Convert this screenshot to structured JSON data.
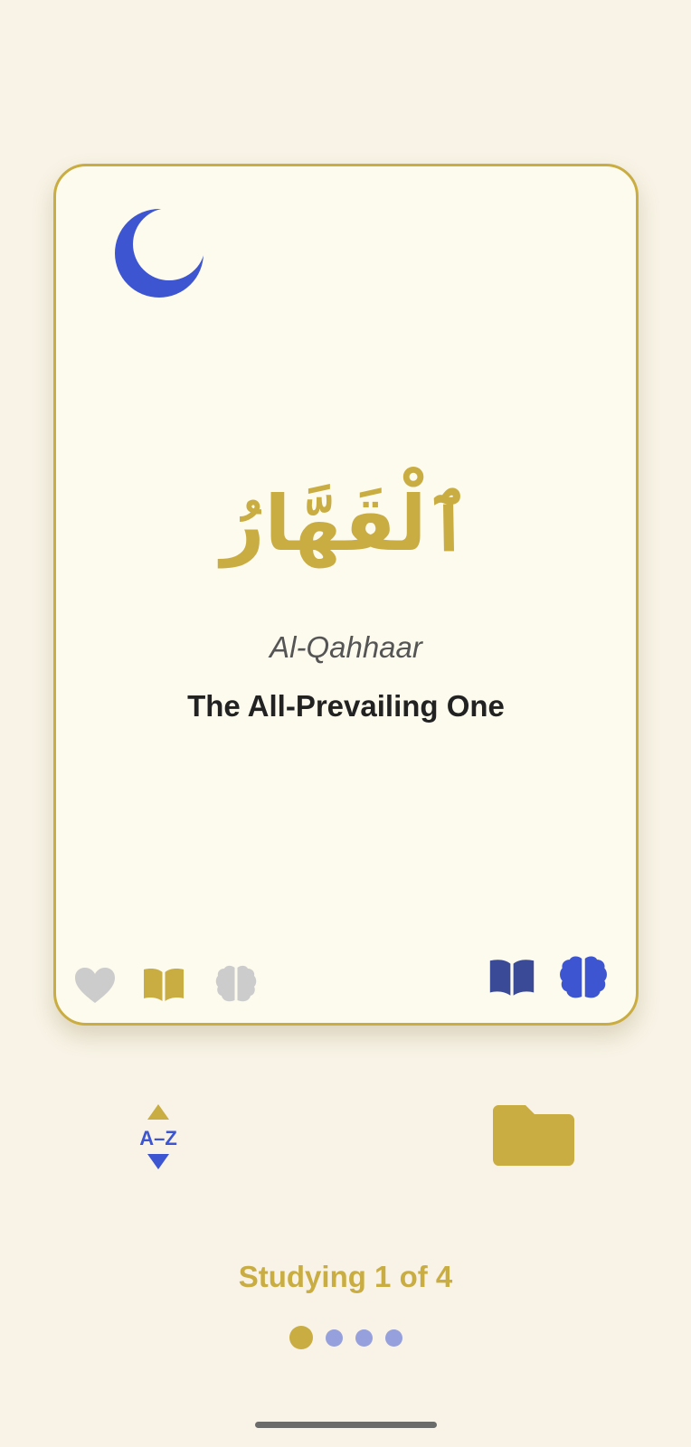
{
  "card": {
    "arabic": "ٱلْقَهَّارُ",
    "transliteration": "Al-Qahhaar",
    "meaning": "The All-Prevailing One",
    "top_icon": "crescent-moon-icon",
    "left_actions": [
      {
        "name": "favorite",
        "icon": "heart-icon",
        "color": "#cccccc"
      },
      {
        "name": "read",
        "icon": "open-book-icon",
        "color": "#c9ad42"
      },
      {
        "name": "memorize",
        "icon": "brain-icon",
        "color": "#cccccc"
      }
    ],
    "right_actions": [
      {
        "name": "study-mode-read",
        "icon": "open-book-icon",
        "color": "#3a4a96"
      },
      {
        "name": "study-mode-memorize",
        "icon": "brain-icon",
        "color": "#3d55d0"
      }
    ]
  },
  "toolbar": {
    "sort_label": "A–Z",
    "sort_icon": "sort-az-icon",
    "folder_icon": "folder-icon"
  },
  "status": {
    "text": "Studying 1 of 4",
    "current": 1,
    "total": 4
  },
  "colors": {
    "background": "#f8f3e6",
    "card": "#fdfaee",
    "gold": "#c9ad42",
    "blue": "#3d55d0",
    "navy": "#3a4a96",
    "light_gray": "#cccccc",
    "dot_inactive": "#96a0dc"
  }
}
